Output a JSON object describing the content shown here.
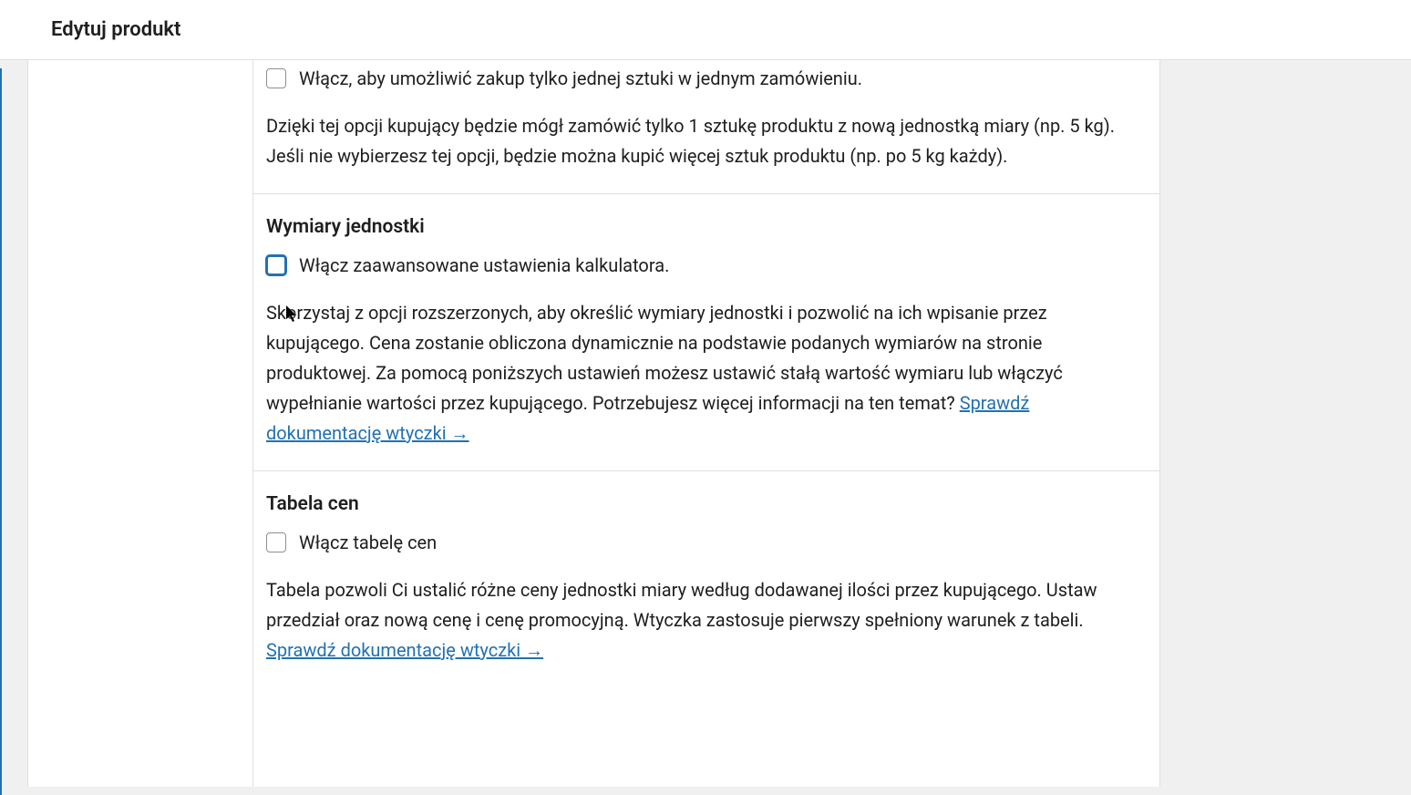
{
  "header": {
    "title": "Edytuj produkt"
  },
  "sections": {
    "single_item": {
      "checkbox_label": "Włącz, aby umożliwić zakup tylko jednej sztuki w jednym zamówieniu.",
      "description": "Dzięki tej opcji kupujący będzie mógł zamówić tylko 1 sztukę produktu z nową jednostką miary (np. 5 kg). Jeśli nie wybierzesz tej opcji, będzie można kupić więcej sztuk produktu (np. po 5 kg każdy)."
    },
    "unit_dimensions": {
      "title": "Wymiary jednostki",
      "checkbox_label": "Włącz zaawansowane ustawienia kalkulatora.",
      "description_before_link": "Skorzystaj z opcji rozszerzonych, aby określić wymiary jednostki i pozwolić na ich wpisanie przez kupującego. Cena zostanie obliczona dynamicznie na podstawie podanych wymiarów na stronie produktowej. Za pomocą poniższych ustawień możesz ustawić stałą wartość wymiaru lub włączyć wypełnianie wartości przez kupującego. Potrzebujesz więcej informacji na ten temat? ",
      "link_text": "Sprawdź dokumentację wtyczki →"
    },
    "price_table": {
      "title": "Tabela cen",
      "checkbox_label": "Włącz tabelę cen",
      "description_before_link": "Tabela pozwoli Ci ustalić różne ceny jednostki miary według dodawanej ilości przez kupującego. Ustaw przedział oraz nową cenę i cenę promocyjną. Wtyczka zastosuje pierwszy spełniony warunek z tabeli. ",
      "link_text": "Sprawdź dokumentację wtyczki →"
    }
  }
}
